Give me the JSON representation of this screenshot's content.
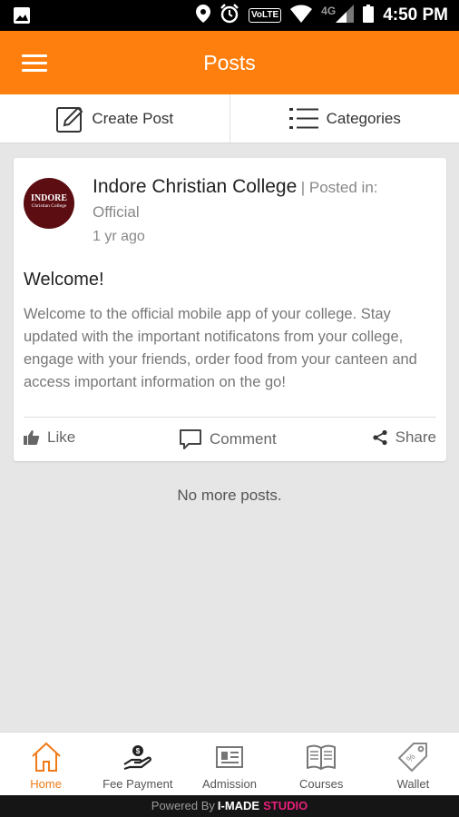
{
  "status_bar": {
    "time": "4:50 PM",
    "volte": "VoLTE",
    "network": "4G",
    "icons": [
      "image-icon",
      "location-icon",
      "alarm-icon",
      "wifi-icon",
      "signal-icon",
      "battery-icon"
    ]
  },
  "header": {
    "title": "Posts",
    "menu_icon": "hamburger-icon"
  },
  "actions": [
    {
      "label": "Create Post",
      "icon": "edit-icon"
    },
    {
      "label": "Categories",
      "icon": "list-icon"
    }
  ],
  "post": {
    "avatar": {
      "line1": "INDORE",
      "line2": "Christian College"
    },
    "author": "Indore Christian College",
    "posted_in": "| Posted in:",
    "category": "Official",
    "time": "1 yr ago",
    "title": "Welcome!",
    "body": "Welcome to the official mobile app of your college. Stay updated with the important notificatons from your college, engage with your friends, order food from your canteen and access important information on the go!",
    "actions": {
      "like": "Like",
      "comment": "Comment",
      "share": "Share"
    }
  },
  "feed_end": "No more posts.",
  "bottom_nav": [
    {
      "label": "Home",
      "icon": "home-icon",
      "active": true
    },
    {
      "label": "Fee Payment",
      "icon": "fee-payment-icon",
      "active": false
    },
    {
      "label": "Admission",
      "icon": "admission-card-icon",
      "active": false
    },
    {
      "label": "Courses",
      "icon": "book-icon",
      "active": false
    },
    {
      "label": "Wallet",
      "icon": "tag-icon",
      "active": false
    }
  ],
  "footer": {
    "prefix": "Powered By",
    "brand_main": "I-MADE",
    "brand_accent": "STUDIO"
  },
  "colors": {
    "primary": "#ff7f0e",
    "active_nav": "#f07a19",
    "brand_accent": "#e91e7a",
    "avatar_bg": "#5b0d12"
  }
}
